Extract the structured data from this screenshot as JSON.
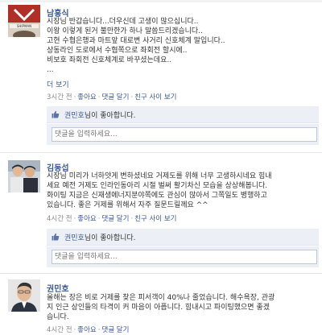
{
  "posts": [
    {
      "author": "남흥식",
      "lines": [
        "시장님 반갑습니다...더우신데 고생이 많으십니다..",
        "이왕 이렇게 된거 불만한가 하나 말씀드리겠습니다..",
        "고현 수협은행과 마트앞 대로변 사거리 신호체계 말입니다..",
        "상동라인 도로에서 수협쪽으로 좌회전 할시에..",
        "비보호 좌회전 신호체계로 바꾸셨는데요..",
        "..."
      ],
      "more_label": "더 보기",
      "meta": {
        "time": "3시간 전",
        "like": "좋아요",
        "comment": "댓글 달기",
        "friend": "친구 사이 보기"
      },
      "likes": {
        "name": "권민호",
        "suffix": "님이 좋아합니다."
      },
      "comment_placeholder": "댓글을 입력하세요..."
    },
    {
      "author": "김동섭",
      "lines": [
        "시장님 미리가 너하얏게 변하셨네요 거제도를 위해 너무 고생하시네요 힘내",
        "세요 예전 거제도 인라인동아리 시절 벌써 활기차신 모습을 상상해봅니다.",
        "화이팅 지금은 신재생에너지분야쪽에도 관심이 많아서 그쪽일도 병행하고",
        "있습니다. 좋은 거제를 위해서 자주 질문드릴께요 ^^"
      ],
      "meta": {
        "time": "4시간 전",
        "like": "좋아요",
        "comment": "댓글 달기",
        "friend": "친구 사이 보기"
      },
      "likes": {
        "name": "권민호",
        "suffix": "님이 좋아합니다."
      },
      "comment_placeholder": "댓글을 입력하세요..."
    },
    {
      "author": "권민호",
      "lines": [
        "올해는 장은 비로 거제를 찾은 피서객이 40%나 줄었습니다. 해수욕장, 관광",
        "지 인근 상인들의 타격이 커 마음이 아픕니다. 힘내시고 파이팅했으면 좋겠",
        "습니다."
      ],
      "meta": {
        "time": "4시간 전",
        "like": "좋아요",
        "comment": "댓글 달기"
      }
    }
  ],
  "colors": {
    "link": "#3b5998",
    "meta": "#8a8a8a",
    "like_bg": "#eceff5"
  },
  "icons": {
    "like": "thumbs-up-icon"
  }
}
